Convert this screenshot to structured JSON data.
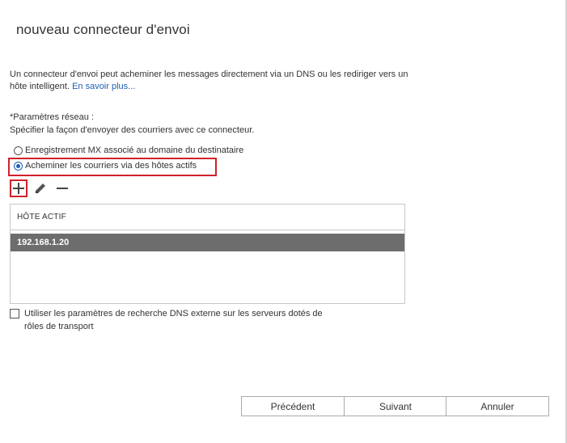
{
  "dialog": {
    "title": "nouveau connecteur d'envoi",
    "intro_text": "Un connecteur d'envoi peut acheminer les messages directement via un DNS ou les rediriger vers un hôte intelligent. ",
    "learn_more_link": "En savoir plus...",
    "network_settings_label": "*Paramètres réseau :",
    "network_settings_desc": "Spécifier la façon d'envoyer des courriers avec ce connecteur.",
    "radio_options": [
      {
        "label": "Enregistrement MX associé au domaine du destinataire",
        "checked": false
      },
      {
        "label": "Acheminer les courriers via des hôtes actifs",
        "checked": true
      }
    ],
    "toolbar": {
      "add_icon": "plus-icon",
      "edit_icon": "pencil-icon",
      "remove_icon": "minus-icon"
    },
    "table": {
      "header": "HÔTE ACTIF",
      "rows": [
        "192.168.1.20"
      ]
    },
    "checkbox": {
      "label_line1": "Utiliser les paramètres de recherche DNS externe sur les serveurs dotés de",
      "label_line2": "rôles de transport",
      "checked": false
    },
    "buttons": {
      "previous": "Précédent",
      "next": "Suivant",
      "cancel": "Annuler"
    }
  },
  "colors": {
    "highlight": "#d0222a",
    "link": "#1f5fb4",
    "selected_row": "#6d6d6d"
  }
}
